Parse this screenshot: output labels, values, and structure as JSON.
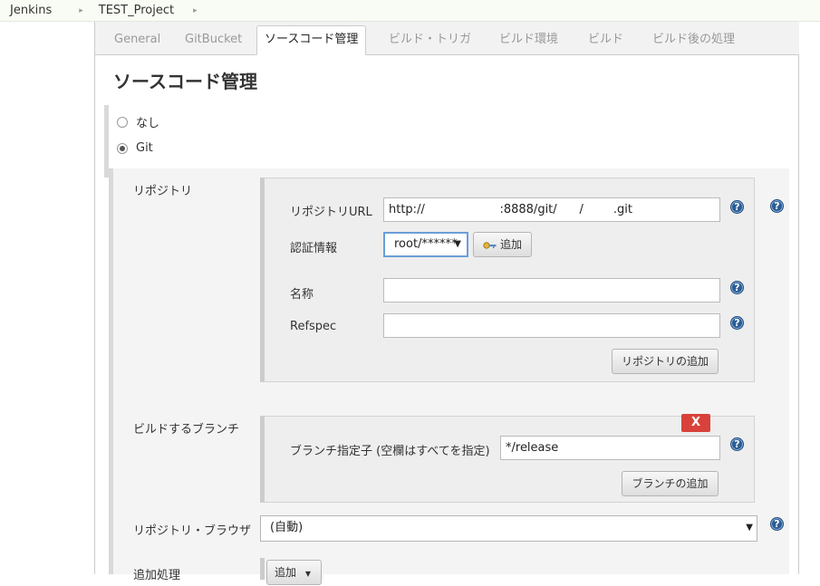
{
  "breadcrumb": [
    "Jenkins",
    "TEST_Project"
  ],
  "tabs": [
    "General",
    "GitBucket",
    "ソースコード管理",
    "ビルド・トリガ",
    "ビルド環境",
    "ビルド",
    "ビルド後の処理"
  ],
  "active_tab": "ソースコード管理",
  "section_title": "ソースコード管理",
  "scm_options": [
    {
      "label": "なし",
      "checked": false
    },
    {
      "label": "Git",
      "checked": true
    }
  ],
  "repositories": {
    "label": "リポジトリ",
    "url_label": "リポジトリURL",
    "url_value": "http://                    :8888/git/      /        .git",
    "credentials_label": "認証情報",
    "credentials_value": "root/******",
    "add_credentials_button": "追加",
    "name_label": "名称",
    "name_value": "",
    "refspec_label": "Refspec",
    "refspec_value": "",
    "add_repository_button": "リポジトリの追加"
  },
  "branches": {
    "label": "ビルドするブランチ",
    "delete_button": "X",
    "specifier_label": "ブランチ指定子 (空欄はすべてを指定)",
    "specifier_value": "*/release",
    "add_branch_button": "ブランチの追加"
  },
  "repository_browser": {
    "label": "リポジトリ・ブラウザ",
    "value": "(自動)"
  },
  "additional_behaviours": {
    "label": "追加処理",
    "add_button": "追加"
  },
  "help_icon_glyph": "?",
  "colors": {
    "help_icon": "#2a5d94",
    "delete_button": "#d9423b",
    "focus_border": "#6a9fd8"
  }
}
